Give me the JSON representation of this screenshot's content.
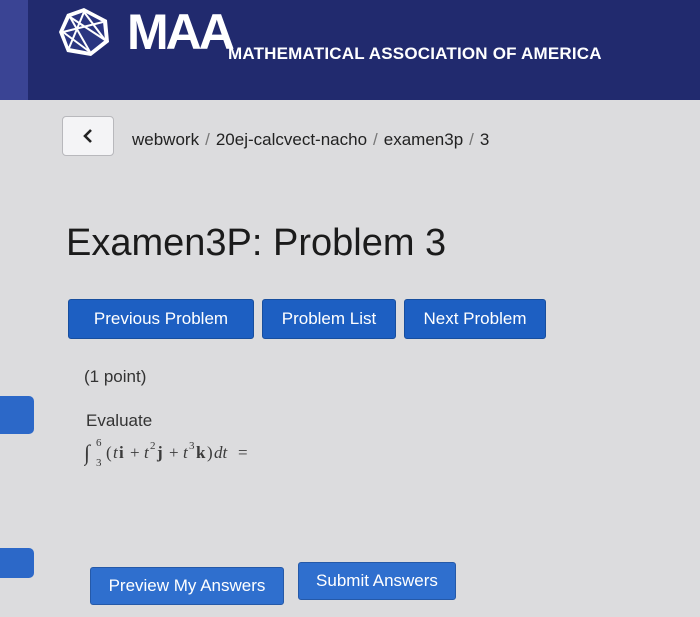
{
  "header": {
    "logo_text": "MAA",
    "subtitle": "MATHEMATICAL ASSOCIATION OF AMERICA"
  },
  "breadcrumb": {
    "back_icon": "chevron-left-icon",
    "items": [
      "webwork",
      "20ej-calcvect-nacho",
      "examen3p",
      "3"
    ],
    "separator": "/"
  },
  "page_title": "Examen3P: Problem 3",
  "nav": {
    "previous_label": "Previous Problem",
    "list_label": "Problem List",
    "next_label": "Next Problem"
  },
  "problem": {
    "points": "(1 point)",
    "prompt": "Evaluate",
    "integral": {
      "sign": "∫",
      "upper": "6",
      "lower": "3",
      "open": "(",
      "t1": "t",
      "i": "i",
      "plus1": "+",
      "t2": "t",
      "exp2": "2",
      "j": "j",
      "plus2": "+",
      "t3": "t",
      "exp3": "3",
      "k": "k",
      "close": ")",
      "dt": "dt",
      "equals": "="
    }
  },
  "actions": {
    "preview_label": "Preview My Answers",
    "submit_label": "Submit Answers"
  },
  "colors": {
    "header_bg": "#212a6e",
    "button_blue": "#1d5fc2",
    "page_bg": "#dcdcde"
  }
}
